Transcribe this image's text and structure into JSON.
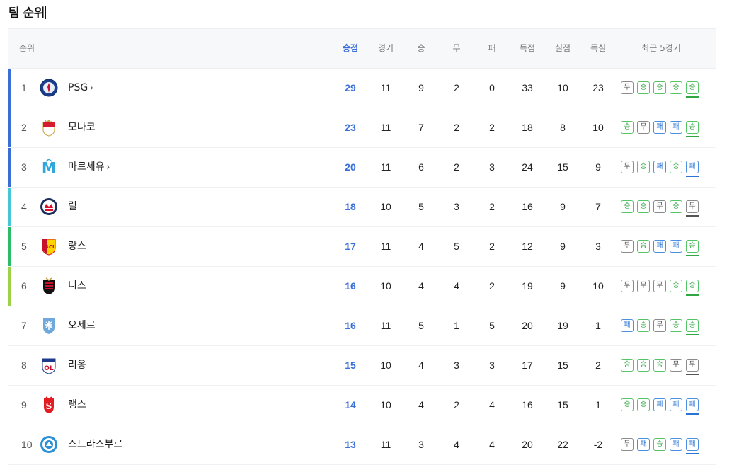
{
  "page": {
    "title": "팀 순위"
  },
  "headers": {
    "rank": "순위",
    "points": "승점",
    "played": "경기",
    "won": "승",
    "drawn": "무",
    "lost": "패",
    "gf": "득점",
    "ga": "실점",
    "gd": "득실",
    "recent": "최근 5경기"
  },
  "colors": {
    "accent": "#3b6fd8",
    "win": "#2fa743",
    "draw": "#555555",
    "loss": "#2a74d4"
  },
  "result_labels": {
    "W": "승",
    "D": "무",
    "L": "패"
  },
  "teams": [
    {
      "rank": "1",
      "name": "PSG",
      "chevron": "›",
      "points": "29",
      "played": "11",
      "won": "9",
      "drawn": "2",
      "lost": "0",
      "gf": "33",
      "ga": "10",
      "gd": "23",
      "bar": "#3b6fd8",
      "logo": "psg-logo-icon",
      "recent": [
        "D",
        "W",
        "W",
        "W",
        "W"
      ]
    },
    {
      "rank": "2",
      "name": "모나코",
      "chevron": "",
      "points": "23",
      "played": "11",
      "won": "7",
      "drawn": "2",
      "lost": "2",
      "gf": "18",
      "ga": "8",
      "gd": "10",
      "bar": "#3b6fd8",
      "logo": "monaco-logo-icon",
      "recent": [
        "W",
        "D",
        "L",
        "L",
        "W"
      ]
    },
    {
      "rank": "3",
      "name": "마르세유",
      "chevron": "›",
      "points": "20",
      "played": "11",
      "won": "6",
      "drawn": "2",
      "lost": "3",
      "gf": "24",
      "ga": "15",
      "gd": "9",
      "bar": "#3b6fd8",
      "logo": "marseille-logo-icon",
      "recent": [
        "D",
        "W",
        "L",
        "W",
        "L"
      ]
    },
    {
      "rank": "4",
      "name": "릴",
      "chevron": "",
      "points": "18",
      "played": "10",
      "won": "5",
      "drawn": "3",
      "lost": "2",
      "gf": "16",
      "ga": "9",
      "gd": "7",
      "bar": "#45c7d6",
      "logo": "lille-logo-icon",
      "recent": [
        "W",
        "W",
        "D",
        "W",
        "D"
      ]
    },
    {
      "rank": "5",
      "name": "랑스",
      "chevron": "",
      "points": "17",
      "played": "11",
      "won": "4",
      "drawn": "5",
      "lost": "2",
      "gf": "12",
      "ga": "9",
      "gd": "3",
      "bar": "#2dbb6a",
      "logo": "lens-logo-icon",
      "recent": [
        "D",
        "W",
        "L",
        "L",
        "W"
      ]
    },
    {
      "rank": "6",
      "name": "니스",
      "chevron": "",
      "points": "16",
      "played": "10",
      "won": "4",
      "drawn": "4",
      "lost": "2",
      "gf": "19",
      "ga": "9",
      "gd": "10",
      "bar": "#9bd24a",
      "logo": "nice-logo-icon",
      "recent": [
        "D",
        "D",
        "D",
        "W",
        "W"
      ]
    },
    {
      "rank": "7",
      "name": "오세르",
      "chevron": "",
      "points": "16",
      "played": "11",
      "won": "5",
      "drawn": "1",
      "lost": "5",
      "gf": "20",
      "ga": "19",
      "gd": "1",
      "bar": "",
      "logo": "auxerre-logo-icon",
      "recent": [
        "L",
        "W",
        "D",
        "W",
        "W"
      ]
    },
    {
      "rank": "8",
      "name": "리옹",
      "chevron": "",
      "points": "15",
      "played": "10",
      "won": "4",
      "drawn": "3",
      "lost": "3",
      "gf": "17",
      "ga": "15",
      "gd": "2",
      "bar": "",
      "logo": "lyon-logo-icon",
      "recent": [
        "W",
        "W",
        "W",
        "D",
        "D"
      ]
    },
    {
      "rank": "9",
      "name": "랭스",
      "chevron": "",
      "points": "14",
      "played": "10",
      "won": "4",
      "drawn": "2",
      "lost": "4",
      "gf": "16",
      "ga": "15",
      "gd": "1",
      "bar": "",
      "logo": "reims-logo-icon",
      "recent": [
        "W",
        "W",
        "L",
        "L",
        "L"
      ]
    },
    {
      "rank": "10",
      "name": "스트라스부르",
      "chevron": "",
      "points": "13",
      "played": "11",
      "won": "3",
      "drawn": "4",
      "lost": "4",
      "gf": "20",
      "ga": "22",
      "gd": "-2",
      "bar": "",
      "logo": "strasbourg-logo-icon",
      "recent": [
        "D",
        "L",
        "W",
        "L",
        "L"
      ]
    }
  ]
}
